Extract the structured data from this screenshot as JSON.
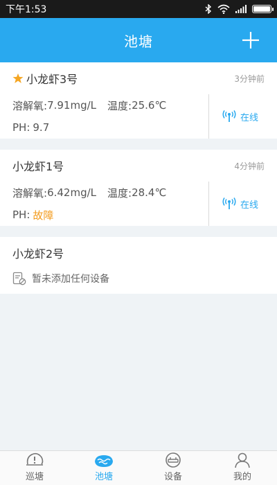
{
  "status_bar": {
    "time": "下午1:53"
  },
  "header": {
    "title": "池塘",
    "add_icon": "plus-icon"
  },
  "ponds": [
    {
      "name": "小龙虾3号",
      "starred": true,
      "time": "3分钟前",
      "oxygen_label": "溶解氧:",
      "oxygen": "7.91mg/L",
      "temp_label": "温度:",
      "temp": "25.6℃",
      "ph_label": "PH:",
      "ph": "9.7",
      "status": "在线"
    },
    {
      "name": "小龙虾1号",
      "starred": false,
      "time": "4分钟前",
      "oxygen_label": "溶解氧:",
      "oxygen": "6.42mg/L",
      "temp_label": "温度:",
      "temp": "28.4℃",
      "ph_label": "PH:",
      "ph": "故障",
      "status": "在线"
    },
    {
      "name": "小龙虾2号",
      "empty_text": "暂未添加任何设备"
    }
  ],
  "tabs": [
    {
      "label": "巡塘",
      "icon": "patrol-icon"
    },
    {
      "label": "池塘",
      "icon": "pond-icon",
      "active": true
    },
    {
      "label": "设备",
      "icon": "device-icon"
    },
    {
      "label": "我的",
      "icon": "user-icon"
    }
  ],
  "colors": {
    "primary": "#29a9ef",
    "fault": "#f39b1c",
    "star": "#f5a623"
  }
}
